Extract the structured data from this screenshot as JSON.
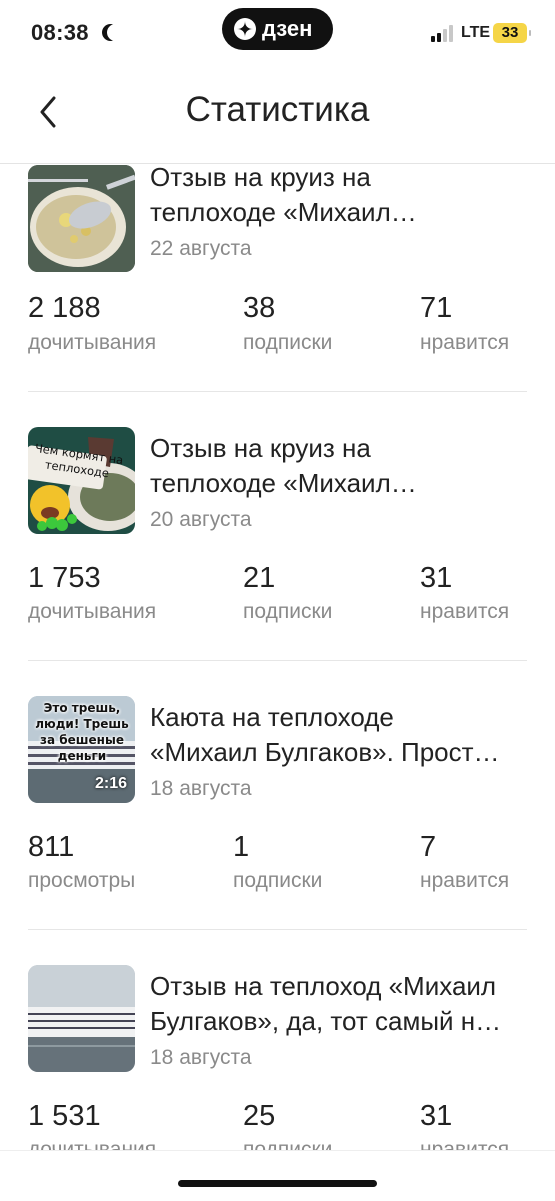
{
  "status_bar": {
    "time": "08:38",
    "carrier": "LTE",
    "battery": "33",
    "app_badge": "дзен"
  },
  "header": {
    "title": "Статистика"
  },
  "articles": [
    {
      "title_line1": "Отзыв на круиз на",
      "title_line2": "теплоходе «Михаил…",
      "date": "22 августа",
      "stats": [
        {
          "value": "2 188",
          "label": "дочитывания"
        },
        {
          "value": "38",
          "label": "подписки"
        },
        {
          "value": "71",
          "label": "нравится"
        }
      ]
    },
    {
      "title_line1": "Отзыв на круиз на",
      "title_line2": "теплоходе «Михаил…",
      "date": "20 августа",
      "thumb_text": "Чем кормят на теплоходе",
      "stats": [
        {
          "value": "1 753",
          "label": "дочитывания"
        },
        {
          "value": "21",
          "label": "подписки"
        },
        {
          "value": "31",
          "label": "нравится"
        }
      ]
    },
    {
      "title_line1": "Каюта на теплоходе",
      "title_line2": "«Михаил Булгаков». Прост…",
      "date": "18 августа",
      "thumb_text": "Это трешь, люди! Трешь за бешеные деньги",
      "duration": "2:16",
      "stats": [
        {
          "value": "811",
          "label": "просмотры"
        },
        {
          "value": "1",
          "label": "подписки"
        },
        {
          "value": "7",
          "label": "нравится"
        }
      ]
    },
    {
      "title_line1": "Отзыв на теплоход «Михаил",
      "title_line2": "Булгаков», да, тот самый н…",
      "date": "18 августа",
      "stats": [
        {
          "value": "1 531",
          "label": "дочитывания"
        },
        {
          "value": "25",
          "label": "подписки"
        },
        {
          "value": "31",
          "label": "нравится"
        }
      ]
    }
  ],
  "icons": {
    "back": "chevron-left-icon",
    "dzen": "dzen-star-icon"
  },
  "colors": {
    "text": "#222222",
    "muted": "#8a8a8a",
    "divider": "#e6e6e6",
    "battery": "#f5d547"
  }
}
